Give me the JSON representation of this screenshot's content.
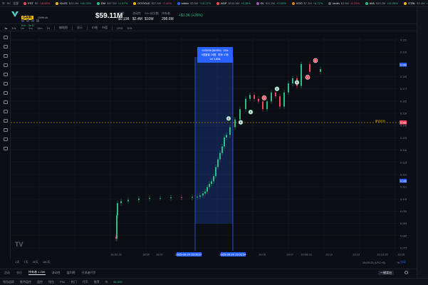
{
  "ticker": {
    "controls": [
      "☰",
      "SC",
      "全部"
    ],
    "items": [
      {
        "sym": "PST",
        "price": "$0",
        "change": "-16.65%",
        "dir": "down",
        "color": "#f6465d"
      },
      {
        "sym": "BUZZ",
        "price": "$25.4M",
        "change": "+46.79%",
        "dir": "up",
        "color": "#f0b90b"
      },
      {
        "sym": "DM",
        "price": "$97.2M",
        "change": "+1.57%",
        "dir": "up",
        "color": "#2ebd85"
      },
      {
        "sym": "GOOGLE",
        "price": "$27.4M",
        "change": "-7.41%",
        "dir": "down",
        "color": "#f0b90b"
      },
      {
        "sym": "lobinx",
        "price": "$3.5M",
        "change": "+19.17%",
        "dir": "up",
        "color": "#2962ff"
      },
      {
        "sym": "AOP",
        "price": "$154.8M",
        "change": "+9.28%",
        "dir": "up",
        "color": "#f6465d"
      },
      {
        "sym": "DL",
        "price": "$11.2M",
        "change": "+9.03%",
        "dir": "up",
        "color": "#9b59b6"
      },
      {
        "sym": "XOO",
        "price": "$7.1M",
        "change": "+8.72%",
        "dir": "up",
        "color": "#e67e22"
      },
      {
        "sym": "lanlin",
        "price": "$1.9M",
        "change": "-6.23%",
        "dir": "down",
        "color": "#5c6370"
      },
      {
        "sym": "AVA",
        "price": "$15.3M",
        "change": "+11.25%",
        "dir": "up",
        "color": "#2ebd85"
      },
      {
        "sym": "GTBL",
        "price": "$2.4M",
        "change": "+5%",
        "dir": "up",
        "color": "#f0b90b"
      }
    ]
  },
  "token": {
    "symbol": "GAIN",
    "name": "GriffinAI",
    "sub": "0xe...3e11",
    "market_cap": "$59.11M",
    "stats": [
      {
        "label": "价格",
        "value": "$0.198"
      },
      {
        "label": "流动性",
        "value": "$2.4M"
      },
      {
        "label": "24h 成交额",
        "value": "$10M"
      },
      {
        "label": "持有者",
        "value": "298.6M"
      }
    ],
    "change": "+$1.3K (+26%)"
  },
  "toolbar": {
    "timeframes": [
      "1s",
      "30s",
      "1m",
      "5m",
      "15m",
      "1h"
    ],
    "active_timeframe": "1s",
    "tools": [
      "蜡烛图",
      "显示",
      "价格",
      "市值",
      "USD",
      "SOL"
    ]
  },
  "ranges": {
    "items": [
      "1天",
      "7天",
      "30天",
      "180天"
    ],
    "clock": "19:09:23 (UTC+8)",
    "pct": "%",
    "auto": "自动"
  },
  "tabs": {
    "items": [
      "活动",
      "仓位",
      "持有者 1.26K",
      "流动性",
      "盈利榜",
      "开发者代币"
    ],
    "active": 2,
    "one_click": "一键卖出"
  },
  "statusbar": {
    "items": [
      "钱包追踪",
      "推特监控",
      "监控",
      "钱包",
      "PNL",
      "热门",
      "代币",
      "推荐",
      "⚙"
    ],
    "money": "$1.50K"
  },
  "chart_data": {
    "type": "candlestick",
    "x_ticks": [
      "18:52:32",
      "18:55",
      "18:57",
      "2025-09-24 19:00:07",
      "2025-09-24 19:02:54",
      "19:05",
      "19:07",
      "19:08:23",
      "19:10",
      "19:13",
      "19:13:20",
      "19:15"
    ],
    "y_ticks": [
      "0.22265",
      "0.19911",
      "0.19535",
      "0.18555",
      "0.17560",
      "0.16265",
      "0.15880",
      "0.14905",
      "0.13820",
      "0.13200",
      "0.12515",
      "0.11840",
      "0.11395",
      "0.10617",
      "0.09999",
      "0.09535",
      "0.08500",
      "0.07500"
    ],
    "highlight_labels": [
      "0.19911",
      "0.16297",
      "0.10617"
    ],
    "key_level_label": "0.16297",
    "key_level_text": "新合约价",
    "tooltip": {
      "line1": "0.092038 (86.95%) · 153s",
      "line2": "K线数量: 25根 · 时间: 47秒",
      "line3": "Vol 3.485k"
    },
    "trade_markers": [
      "B",
      "B",
      "B",
      "S",
      "B",
      "B",
      "S",
      "S"
    ],
    "price_series": [
      0.071,
      0.0695,
      0.0875,
      0.097,
      0.0985,
      0.0995,
      0.1005,
      0.101,
      0.101,
      0.1015,
      0.1012,
      0.1018,
      0.102,
      0.103,
      0.1045,
      0.106,
      0.1095,
      0.112,
      0.114,
      0.118,
      0.125,
      0.131,
      0.136,
      0.141,
      0.148,
      0.15,
      0.156,
      0.162,
      0.17,
      0.178,
      0.181,
      0.178,
      0.176,
      0.17,
      0.176,
      0.183,
      0.18,
      0.172,
      0.183,
      0.19,
      0.194,
      0.188,
      0.205,
      0.199,
      0.201
    ]
  }
}
